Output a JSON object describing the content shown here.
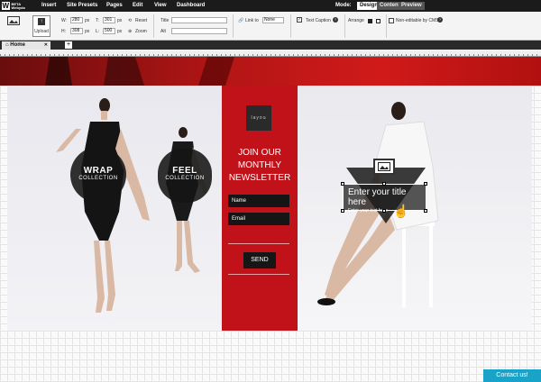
{
  "topbar": {
    "logo_letter": "W",
    "logo_text_1": "BETA",
    "logo_text_2": "Webydo",
    "menu": [
      "Insert",
      "Site Presets",
      "Pages",
      "Edit",
      "View",
      "Dashboard"
    ],
    "mode_label": "Mode:",
    "modes": [
      "Design",
      "Content",
      "Preview"
    ],
    "active_mode": "Design"
  },
  "toolbar": {
    "upload_label": "Upload",
    "w_label": "W:",
    "w_value": "280",
    "w_unit": "px",
    "h_label": "H:",
    "h_value": "308",
    "h_unit": "px",
    "t_label": "T:",
    "t_value": "301",
    "t_unit": "px",
    "l_label": "L:",
    "l_value": "500",
    "l_unit": "px",
    "reset_label": "Reset",
    "zoom_label": "Zoom",
    "title_label": "Title",
    "alt_label": "Alt",
    "link_label": "Link to",
    "link_value": "None",
    "text_caption_label": "Text Caption",
    "arrange_label": "Arrange",
    "noneditable_label": "Non-editable by CMS"
  },
  "tabs": {
    "home": "Home",
    "add": "+"
  },
  "page": {
    "wrap_big": "WRAP",
    "wrap_small": "COLLECTION",
    "feel_big": "FEEL",
    "feel_small": "COLLECTION",
    "brand": "layou",
    "join": "JOIN OUR",
    "monthly": "MONTHLY",
    "newsletter": "NEWSLETTER",
    "name_placeholder": "Name",
    "email_placeholder": "Email",
    "send": "SEND",
    "title": "Enter your title here",
    "subtitle": "Enter your text here"
  },
  "contact": "Contact us!",
  "colors": {
    "accent_red": "#c1121a",
    "topbar": "#1b1b1b",
    "contact": "#1aa3c8"
  }
}
